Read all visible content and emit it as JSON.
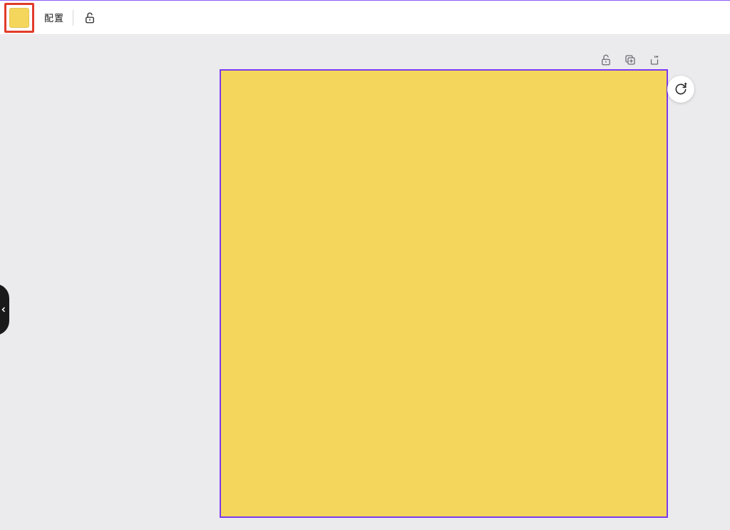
{
  "toolbar": {
    "arrange_label": "配置",
    "swatch_color": "#f5d65c"
  },
  "shape": {
    "fill_color": "#f4d65c",
    "selection_color": "#7c3aed"
  }
}
